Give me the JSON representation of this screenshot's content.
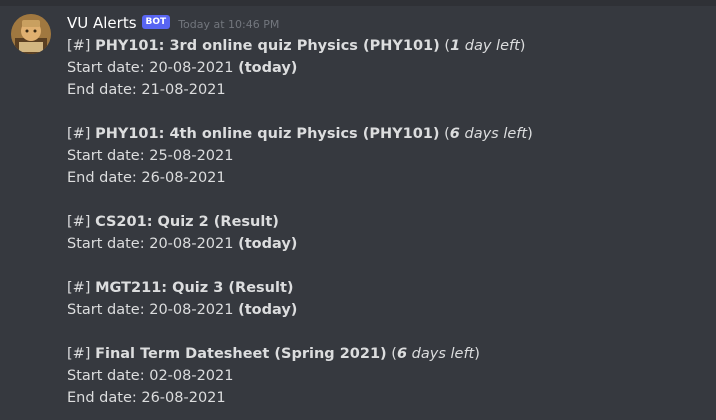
{
  "message": {
    "username": "VU Alerts",
    "bot_tag": "BOT",
    "timestamp": "Today at 10:46 PM",
    "alerts": [
      {
        "prefix": "[#]",
        "title": "PHY101: 3rd online quiz Physics (PHY101)",
        "days_left_num": "1",
        "days_left_text": "day left",
        "start_label": "Start date: 20-08-2021",
        "start_note": "(today)",
        "end_label": "End date: 21-08-2021"
      },
      {
        "prefix": "[#]",
        "title": "PHY101: 4th online quiz Physics (PHY101)",
        "days_left_num": "6",
        "days_left_text": "days left",
        "start_label": "Start date: 25-08-2021",
        "end_label": "End date: 26-08-2021"
      },
      {
        "prefix": "[#]",
        "title": "CS201: Quiz 2 (Result)",
        "start_label": "Start date: 20-08-2021",
        "start_note": "(today)"
      },
      {
        "prefix": "[#]",
        "title": "MGT211: Quiz 3 (Result)",
        "start_label": "Start date: 20-08-2021",
        "start_note": "(today)"
      },
      {
        "prefix": "[#]",
        "title": "Final Term Datesheet (Spring 2021)",
        "days_left_num": "6",
        "days_left_text": "days left",
        "start_label": "Start date: 02-08-2021",
        "end_label": "End date: 26-08-2021"
      }
    ]
  },
  "colors": {
    "background": "#36393f",
    "text": "#dcddde",
    "username": "#ffffff",
    "bot_tag_bg": "#5865f2",
    "timestamp": "#72767d"
  },
  "icons": {
    "avatar": "bot-avatar-icon"
  }
}
